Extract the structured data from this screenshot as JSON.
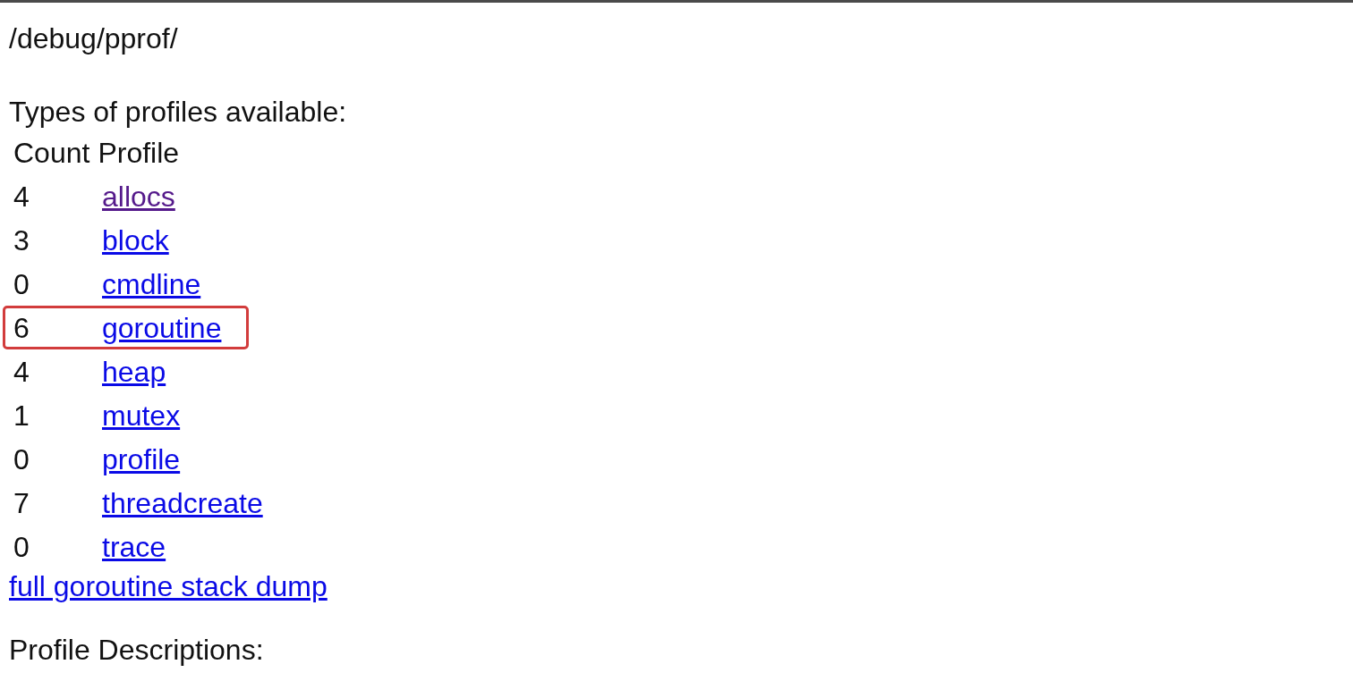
{
  "page": {
    "title": "/debug/pprof/"
  },
  "profiles_heading": "Types of profiles available:",
  "table": {
    "columns": [
      "Count",
      "Profile"
    ],
    "rows": [
      {
        "count": "4",
        "profile": "allocs",
        "visited": true,
        "highlighted": false
      },
      {
        "count": "3",
        "profile": "block",
        "visited": false,
        "highlighted": false
      },
      {
        "count": "0",
        "profile": "cmdline",
        "visited": false,
        "highlighted": false
      },
      {
        "count": "6",
        "profile": "goroutine",
        "visited": false,
        "highlighted": true
      },
      {
        "count": "4",
        "profile": "heap",
        "visited": false,
        "highlighted": false
      },
      {
        "count": "1",
        "profile": "mutex",
        "visited": false,
        "highlighted": false
      },
      {
        "count": "0",
        "profile": "profile",
        "visited": false,
        "highlighted": false
      },
      {
        "count": "7",
        "profile": "threadcreate",
        "visited": false,
        "highlighted": false
      },
      {
        "count": "0",
        "profile": "trace",
        "visited": false,
        "highlighted": false
      }
    ]
  },
  "full_dump_link": {
    "label": "full goroutine stack dump",
    "visited": false
  },
  "descriptions_heading": "Profile Descriptions:"
}
